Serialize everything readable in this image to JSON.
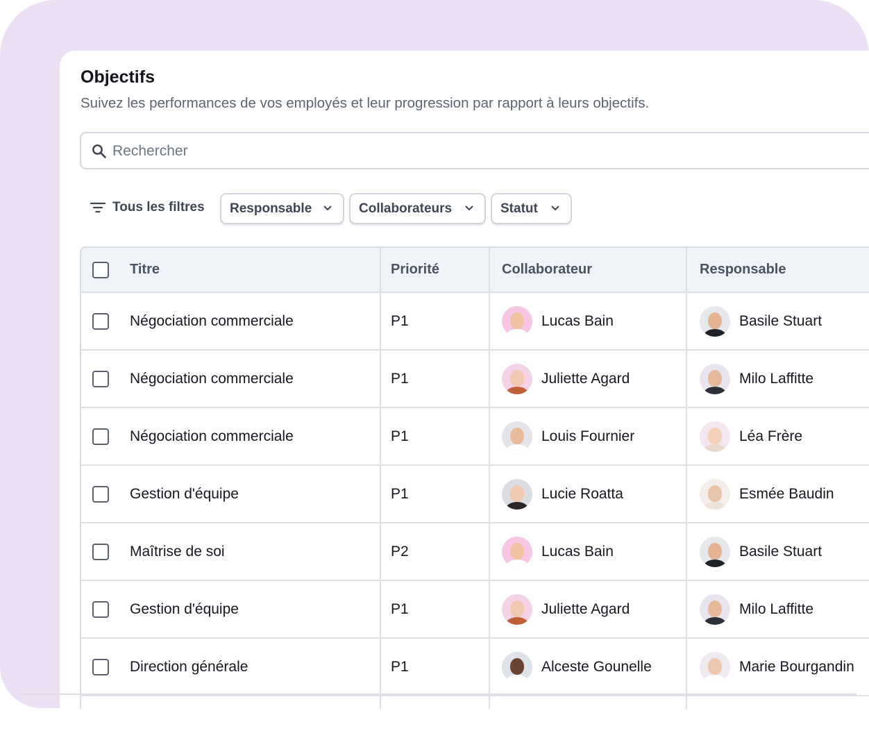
{
  "header": {
    "title": "Objectifs",
    "subtitle": "Suivez les performances de vos employés et leur progression par rapport à leurs objectifs."
  },
  "search": {
    "placeholder": "Rechercher",
    "icon": "search-icon"
  },
  "filters": {
    "all_label": "Tous les filtres",
    "chips": [
      {
        "label": "Responsable"
      },
      {
        "label": "Collaborateurs"
      },
      {
        "label": "Statut"
      }
    ]
  },
  "table": {
    "columns": [
      "Titre",
      "Priorité",
      "Collaborateur",
      "Responsable"
    ],
    "rows": [
      {
        "title": "Négociation commerciale",
        "priority": "P1",
        "collaborator": "Lucas Bain",
        "manager": "Basile Stuart"
      },
      {
        "title": "Négociation commerciale",
        "priority": "P1",
        "collaborator": "Juliette Agard",
        "manager": "Milo Laffitte"
      },
      {
        "title": "Négociation commerciale",
        "priority": "P1",
        "collaborator": "Louis Fournier",
        "manager": "Léa Frère"
      },
      {
        "title": "Gestion d'équipe",
        "priority": "P1",
        "collaborator": "Lucie Roatta",
        "manager": "Esmée Baudin"
      },
      {
        "title": "Maîtrise de soi",
        "priority": "P2",
        "collaborator": "Lucas Bain",
        "manager": "Basile Stuart"
      },
      {
        "title": "Gestion d'équipe",
        "priority": "P1",
        "collaborator": "Juliette Agard",
        "manager": "Milo Laffitte"
      },
      {
        "title": "Direction générale",
        "priority": "P1",
        "collaborator": "Alceste Gounelle",
        "manager": "Marie Bourgandin"
      }
    ]
  },
  "avatar_colors": {
    "Lucas Bain": {
      "bg": "#f7c6e3",
      "skin": "#efc2a4",
      "shirt": "#ffffff"
    },
    "Juliette Agard": {
      "bg": "#f4d3e6",
      "skin": "#f2c7b0",
      "shirt": "#c0603a"
    },
    "Louis Fournier": {
      "bg": "#e4e4ea",
      "skin": "#e8bc9a",
      "shirt": "#ffffff"
    },
    "Lucie Roatta": {
      "bg": "#dcdde2",
      "skin": "#f0c9ae",
      "shirt": "#2a2526"
    },
    "Alceste Gounelle": {
      "bg": "#dfe2e8",
      "skin": "#6b4431",
      "shirt": "#ffffff"
    },
    "Basile Stuart": {
      "bg": "#e7e8ec",
      "skin": "#e3b392",
      "shirt": "#1f2328"
    },
    "Milo Laffitte": {
      "bg": "#e9e4ee",
      "skin": "#e6b99b",
      "shirt": "#2b2f36"
    },
    "Léa Frère": {
      "bg": "#f4e6ee",
      "skin": "#f3d0b8",
      "shirt": "#e9d8cc"
    },
    "Esmée Baudin": {
      "bg": "#f5ecec",
      "skin": "#e8c4a8",
      "shirt": "#ede2da"
    },
    "Marie Bourgandin": {
      "bg": "#eeeaf0",
      "skin": "#edc8ad",
      "shirt": "#ffffff"
    }
  }
}
